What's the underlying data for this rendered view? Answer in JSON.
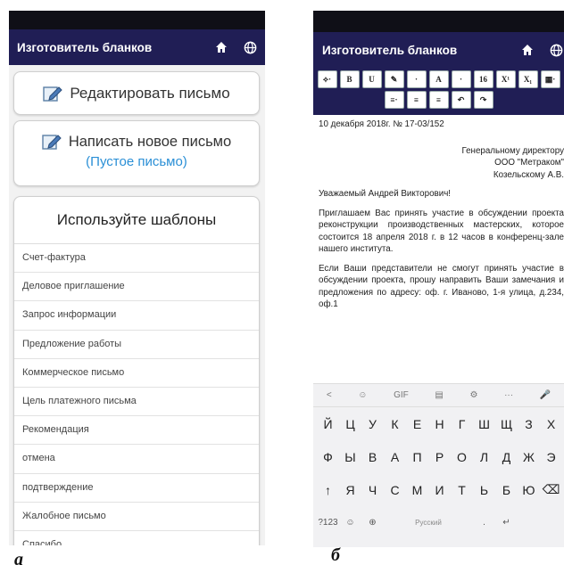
{
  "phone_a": {
    "app_title": "Изготовитель бланков",
    "edit_button": "Редактировать письмо",
    "new_button": "Написать новое письмо",
    "new_button_sub": "(Пустое письмо)",
    "templates_title": "Используйте шаблоны",
    "templates": [
      "Счет-фактура",
      "Деловое приглашение",
      "Запрос информации",
      "Предложение работы",
      "Коммерческое письмо",
      "Цель платежного письма",
      "Рекомендация",
      "отмена",
      "подтверждение",
      "Жалобное письмо",
      "Спасибо"
    ],
    "figure_label": "а"
  },
  "phone_b": {
    "app_title": "Изготовитель бланков",
    "toolbar_row1": [
      "⟡·",
      "B",
      "U",
      "✎",
      "·",
      "A",
      "·",
      "16",
      "X¹",
      "X₁",
      "▦·"
    ],
    "toolbar_row2": [
      "≡·",
      "≡",
      "≡",
      "↶",
      "↷"
    ],
    "doc": {
      "date_line": "10 декабря 2018г. № 17-03/152",
      "to1": "Генеральному директору",
      "to2": "ООО \"Метраком\"",
      "to3": "Козельскому А.В.",
      "greeting": "Уважаемый Андрей Викторович!",
      "para1": "Приглашаем Вас принять участие в обсуждении проекта реконструкции производственных мастерских, которое состоится 18 апреля 2018 г. в 12 часов в конференц-зале нашего института.",
      "para2": "Если Ваши представители не смогут принять участие в обсуждении проекта, прошу направить Ваши замечания и предложения по адресу: оф. г. Иваново, 1-я улица, д.234, оф.1"
    },
    "suggestion_bar": [
      "<",
      "☺",
      "GIF",
      "▤",
      "⚙",
      "···",
      "🎤"
    ],
    "kb_row1": [
      "Й",
      "Ц",
      "У",
      "К",
      "Е",
      "Н",
      "Г",
      "Ш",
      "Щ",
      "З",
      "Х"
    ],
    "kb_row2": [
      "Ф",
      "Ы",
      "В",
      "А",
      "П",
      "Р",
      "О",
      "Л",
      "Д",
      "Ж",
      "Э"
    ],
    "kb_row3": [
      "↑",
      "Я",
      "Ч",
      "С",
      "М",
      "И",
      "Т",
      "Ь",
      "Б",
      "Ю",
      "⌫"
    ],
    "kb_row4": [
      "?123",
      "☺",
      "⊕",
      "Русский",
      ".",
      "↵"
    ],
    "figure_label": "б"
  },
  "colors": {
    "appbar": "#201e55",
    "link": "#2a8fd6"
  }
}
